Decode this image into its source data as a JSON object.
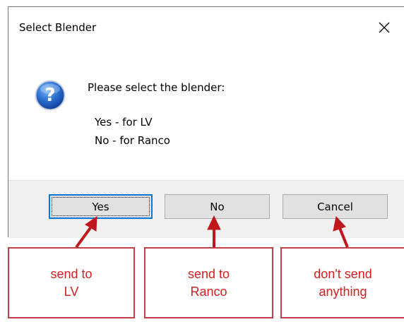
{
  "dialog": {
    "title": "Select Blender",
    "message": "Please select the blender:",
    "option_yes": "Yes - for LV",
    "option_no": "No - for Ranco",
    "icon": "question-icon",
    "close_icon": "close-icon"
  },
  "buttons": {
    "yes": "Yes",
    "no": "No",
    "cancel": "Cancel"
  },
  "annotations": [
    {
      "line1": "send to",
      "line2": "LV"
    },
    {
      "line1": "send to",
      "line2": "Ranco"
    },
    {
      "line1": "don't send",
      "line2": "anything"
    }
  ],
  "colors": {
    "annotation_red": "#d62020",
    "arrow_red": "#c0161c",
    "focus_blue": "#0078d7",
    "footer_gray": "#f0f0f0"
  }
}
